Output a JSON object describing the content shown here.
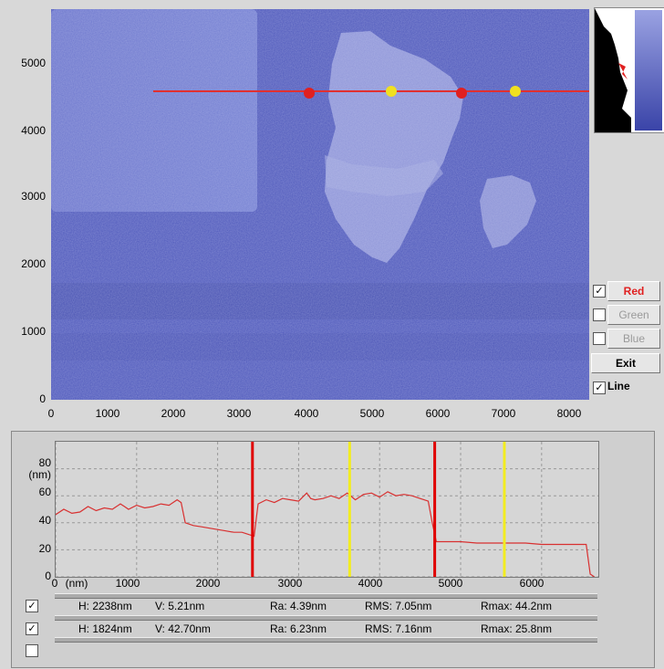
{
  "image": {
    "y_ticks": [
      "5000",
      "4000",
      "3000",
      "2000",
      "1000",
      "0"
    ],
    "x_ticks": [
      "0",
      "1000",
      "2000",
      "3000",
      "4000",
      "5000",
      "6000",
      "7000",
      "8000"
    ]
  },
  "controls": {
    "red": {
      "label": "Red",
      "checked": true
    },
    "green": {
      "label": "Green",
      "checked": false
    },
    "blue": {
      "label": "Blue",
      "checked": false
    },
    "exit_label": "Exit",
    "line": {
      "label": "Line",
      "checked": true
    },
    "check_mark": "✓"
  },
  "chart_data": {
    "type": "line",
    "ylabel": "(nm)",
    "xlabel": "(nm)",
    "xlim": [
      0,
      6700
    ],
    "ylim": [
      0,
      100
    ],
    "y_ticks": [
      "80",
      "60",
      "40",
      "20",
      "0"
    ],
    "x_ticks": [
      "0",
      "1000",
      "2000",
      "3000",
      "4000",
      "5000",
      "6000"
    ],
    "x_tick_values": [
      0,
      1000,
      2000,
      3000,
      4000,
      5000,
      6000
    ],
    "y_tick_values": [
      0,
      20,
      40,
      60,
      80
    ],
    "series": [
      {
        "x": [
          0,
          100,
          200,
          300,
          400,
          500,
          600,
          700,
          800,
          850,
          900,
          1000,
          1100,
          1200,
          1300,
          1400,
          1500,
          1550,
          1600,
          1700,
          1800,
          1900,
          2000,
          2100,
          2200,
          2300,
          2400,
          2450,
          2500,
          2600,
          2700,
          2800,
          2900,
          3000,
          3100,
          3150,
          3200,
          3300,
          3400,
          3500,
          3600,
          3700,
          3800,
          3900,
          4000,
          4100,
          4200,
          4300,
          4400,
          4500,
          4600,
          4650,
          4700,
          4800,
          5000,
          5200,
          5400,
          5600,
          5800,
          6000,
          6200,
          6400,
          6500,
          6550,
          6600,
          6650
        ],
        "y": [
          46,
          50,
          47,
          48,
          52,
          49,
          51,
          50,
          54,
          52,
          50,
          53,
          51,
          52,
          54,
          53,
          57,
          55,
          40,
          38,
          37,
          36,
          35,
          34,
          33,
          33,
          31,
          30,
          54,
          57,
          55,
          58,
          57,
          56,
          62,
          58,
          57,
          58,
          60,
          58,
          62,
          57,
          61,
          62,
          59,
          63,
          60,
          61,
          60,
          58,
          56,
          40,
          26,
          26,
          26,
          25,
          25,
          25,
          25,
          24,
          24,
          24,
          24,
          24,
          2,
          0
        ]
      }
    ],
    "cursors": {
      "red": [
        2430,
        4680
      ],
      "yellow": [
        3630,
        5540
      ]
    }
  },
  "stats": [
    {
      "checked": true,
      "H": "H: 2238nm",
      "V": "V: 5.21nm",
      "Ra": "Ra: 4.39nm",
      "RMS": "RMS: 7.05nm",
      "Rmax": "Rmax: 44.2nm"
    },
    {
      "checked": true,
      "H": "H: 1824nm",
      "V": "V: 42.70nm",
      "Ra": "Ra: 6.23nm",
      "RMS": "RMS: 7.16nm",
      "Rmax": "Rmax: 25.8nm"
    },
    {
      "checked": false
    }
  ]
}
